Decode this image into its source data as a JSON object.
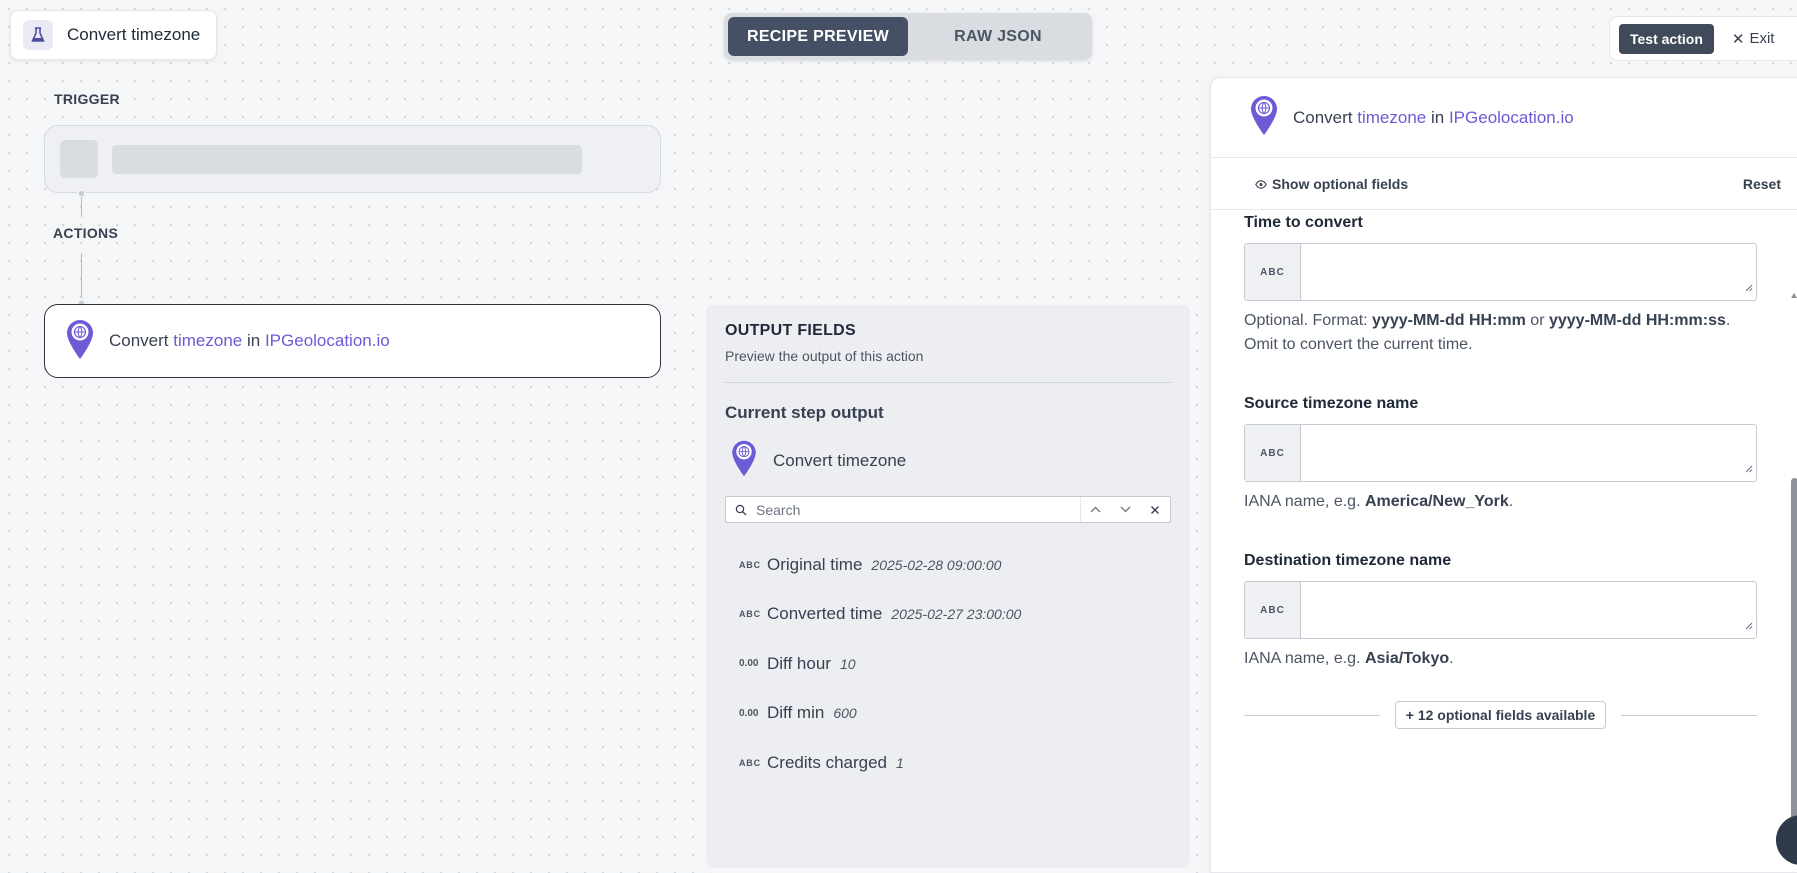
{
  "header": {
    "title": "Convert timezone",
    "tabs": [
      {
        "label": "RECIPE PREVIEW",
        "active": true
      },
      {
        "label": "RAW JSON",
        "active": false
      }
    ],
    "test_action_label": "Test action",
    "exit_label": "Exit"
  },
  "flow": {
    "trigger_label": "TRIGGER",
    "actions_label": "ACTIONS",
    "action_step": {
      "prefix": "Convert",
      "object": "timezone",
      "joiner": "in",
      "app": "IPGeolocation.io"
    }
  },
  "output": {
    "heading": "OUTPUT FIELDS",
    "subheading": "Preview the output of this action",
    "current_step_label": "Current step output",
    "step_name": "Convert timezone",
    "search_placeholder": "Search",
    "fields": [
      {
        "type": "ABC",
        "label": "Original time",
        "value": "2025-02-28 09:00:00"
      },
      {
        "type": "ABC",
        "label": "Converted time",
        "value": "2025-02-27 23:00:00"
      },
      {
        "type": "0.00",
        "label": "Diff hour",
        "value": "10"
      },
      {
        "type": "0.00",
        "label": "Diff min",
        "value": "600"
      },
      {
        "type": "ABC",
        "label": "Credits charged",
        "value": "1"
      }
    ]
  },
  "side_panel": {
    "title_prefix": "Convert",
    "title_object": "timezone",
    "title_joiner": "in",
    "title_app": "IPGeolocation.io",
    "show_optional_label": "Show optional fields",
    "reset_label": "Reset",
    "fields": [
      {
        "label": "Time to convert",
        "badge": "ABC",
        "value": "",
        "hint_parts": [
          "Optional. Format: ",
          "yyyy-MM-dd HH:mm",
          " or ",
          "yyyy-MM-dd HH:mm:ss",
          ".",
          "Omit to convert the current time."
        ]
      },
      {
        "label": "Source timezone name",
        "badge": "ABC",
        "value": "",
        "hint_parts": [
          "IANA name, e.g. ",
          "America/New_York",
          "."
        ]
      },
      {
        "label": "Destination timezone name",
        "badge": "ABC",
        "value": "",
        "hint_parts": [
          "IANA name, e.g. ",
          "Asia/Tokyo",
          "."
        ]
      }
    ],
    "optional_fields_button": "+ 12 optional fields available"
  },
  "colors": {
    "accent": "#6b5bd6",
    "dark_button": "#414a5a",
    "active_tab": "#465064"
  }
}
